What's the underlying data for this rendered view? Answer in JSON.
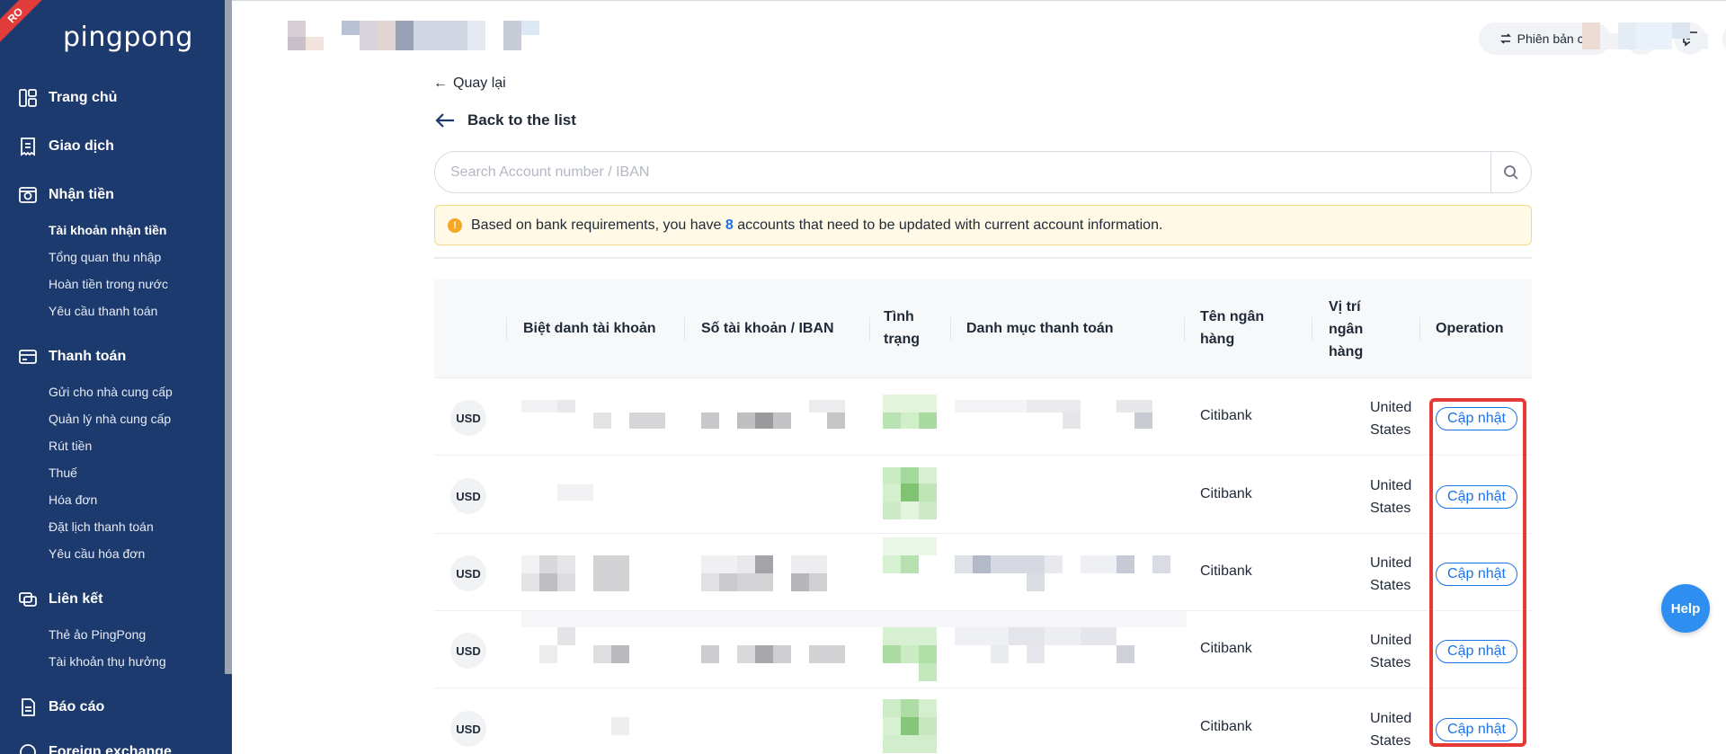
{
  "app": {
    "ribbon": "RO",
    "logo": "pingpong"
  },
  "sidebar": {
    "sections": [
      {
        "label": "Trang chủ",
        "icon": "dashboard-icon"
      },
      {
        "label": "Giao dịch",
        "icon": "receipt-icon"
      },
      {
        "label": "Nhận tiền",
        "icon": "receive-money-icon"
      },
      {
        "label": "Thanh toán",
        "icon": "payment-card-icon"
      },
      {
        "label": "Liên kết",
        "icon": "link-cards-icon"
      },
      {
        "label": "Báo cáo",
        "icon": "report-icon"
      },
      {
        "label": "Foreign exchange",
        "icon": "exchange-icon"
      }
    ],
    "receive_items": [
      "Tài khoản nhận tiền",
      "Tổng quan thu nhập",
      "Hoàn tiền trong nước",
      "Yêu cầu thanh toán"
    ],
    "payment_items": [
      "Gửi cho nhà cung cấp",
      "Quản lý nhà cung cấp",
      "Rút tiền",
      "Thuế",
      "Hóa đơn",
      "Đặt lịch thanh toán",
      "Yêu cầu hóa đơn"
    ],
    "link_items": [
      "Thẻ ảo PingPong",
      "Tài khoản thụ hưởng"
    ]
  },
  "header": {
    "old_version_label": "Phiên bản cũ",
    "icons": [
      "calendar-icon",
      "message-icon",
      "help-circle-icon",
      "user-icon"
    ]
  },
  "main": {
    "back_label": "Quay lại",
    "back_to_list_label": "Back to the list",
    "search_placeholder": "Search Account number / IBAN",
    "alert": {
      "before": "Based on bank requirements, you have",
      "count": "8",
      "after": "accounts that need to be updated with current account information."
    },
    "columns": [
      "Biệt danh tài khoản",
      "Số tài khoản / IBAN",
      "Tình trạng",
      "Danh mục thanh toán",
      "Tên ngân hàng",
      "Vị trí ngân hàng",
      "Operation"
    ],
    "rows": [
      {
        "currency": "USD",
        "bank": "Citibank",
        "location": "United States",
        "action": "Cập nhật"
      },
      {
        "currency": "USD",
        "bank": "Citibank",
        "location": "United States",
        "action": "Cập nhật"
      },
      {
        "currency": "USD",
        "bank": "Citibank",
        "location": "United States",
        "action": "Cập nhật"
      },
      {
        "currency": "USD",
        "bank": "Citibank",
        "location": "United States",
        "action": "Cập nhật"
      },
      {
        "currency": "USD",
        "bank": "Citibank",
        "location": "United States",
        "action": "Cập nhật"
      }
    ]
  },
  "help_label": "Help",
  "colors": {
    "sidebar_bg": "#1d3a6e",
    "accent": "#1a73e8",
    "highlight": "#e53935",
    "alert_bg": "#fff9e6"
  }
}
